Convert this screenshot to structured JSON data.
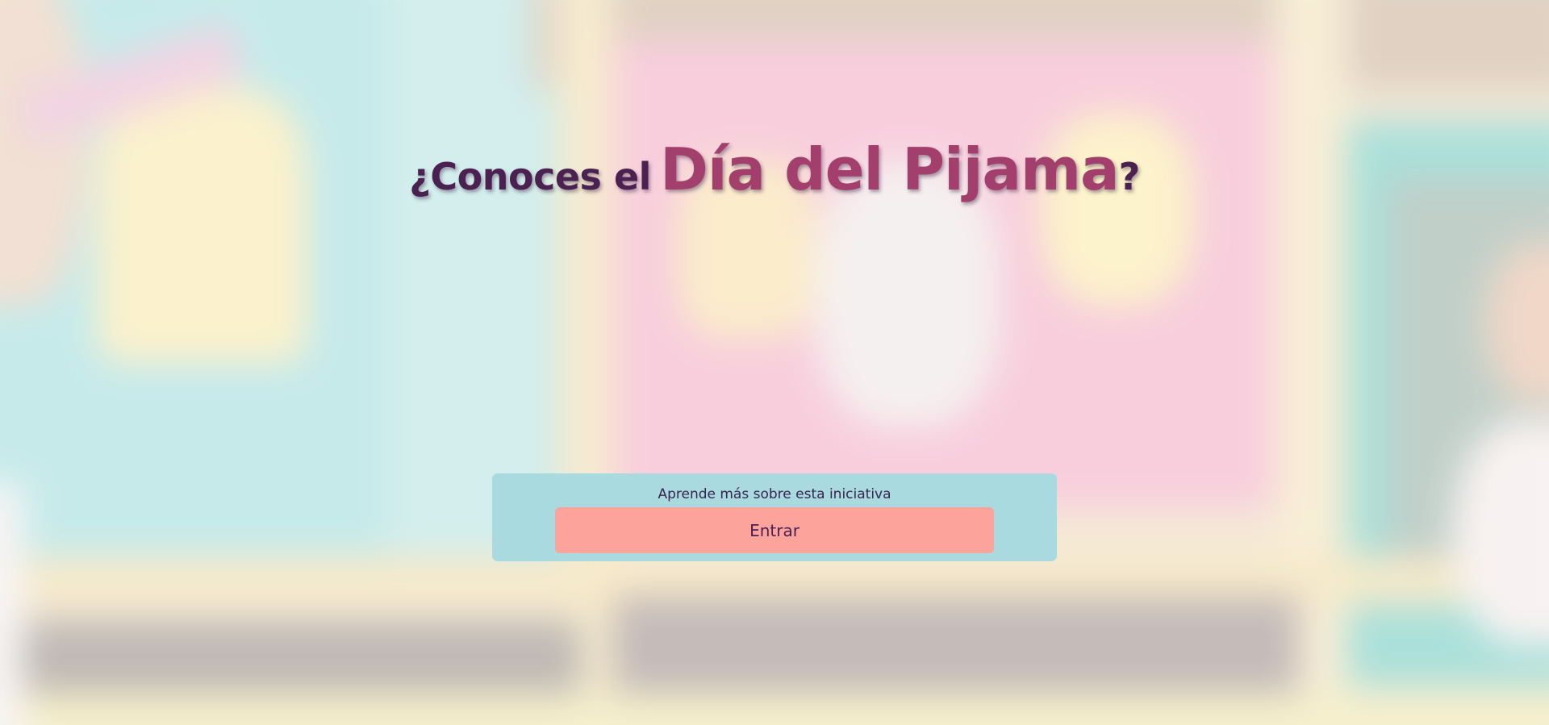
{
  "hero": {
    "headline_prefix": "¿Conoces el",
    "headline_highlight": "Día del Pijama",
    "headline_suffix": "?"
  },
  "cta_panel": {
    "label": "Aprende más sobre esta iniciativa",
    "button_label": "Entrar"
  },
  "colors": {
    "headline_dark": "#4a2150",
    "headline_accent": "#a33f6d",
    "panel_background": "#a8dadf",
    "button_background": "#fca49b"
  }
}
